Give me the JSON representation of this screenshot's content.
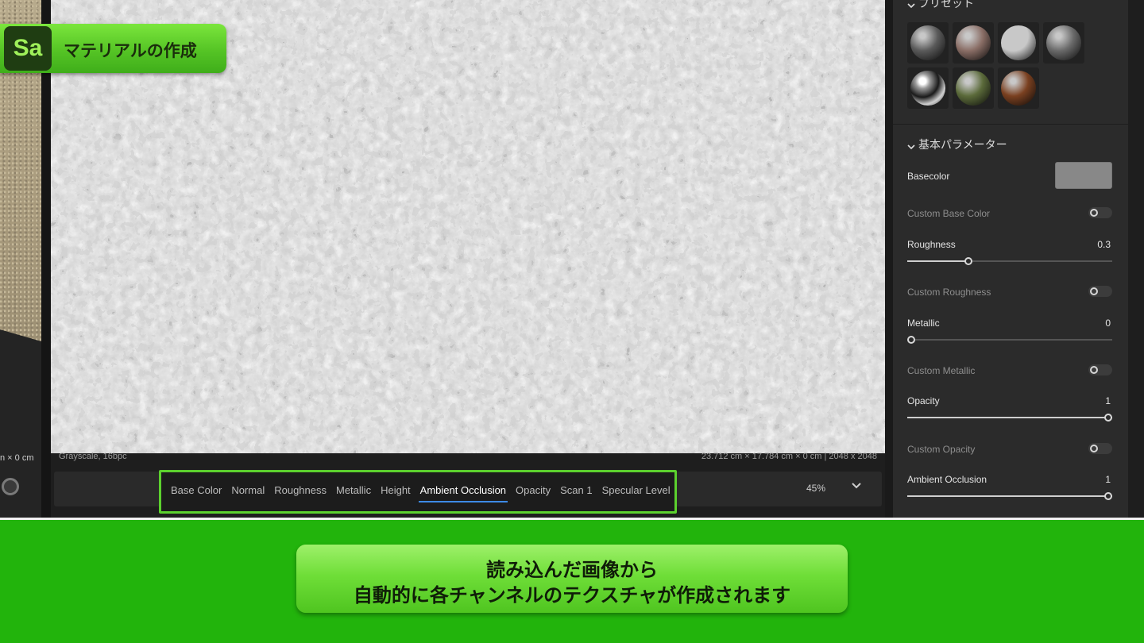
{
  "overlay": {
    "app_logo_text": "Sa",
    "title": "マテリアルの作成",
    "caption_line1": "読み込んだ画像から",
    "caption_line2": "自動的に各チャンネルのテクスチャが作成されます"
  },
  "viewport3d": {
    "dims_text": "n × 0 cm"
  },
  "texture_view": {
    "info_left": "Grayscale, 16bpc",
    "info_right": "23.712 cm × 17.784 cm × 0 cm  |  2048 x 2048"
  },
  "channels": {
    "tabs": [
      "Base Color",
      "Normal",
      "Roughness",
      "Metallic",
      "Height",
      "Ambient Occlusion",
      "Opacity",
      "Scan 1",
      "Specular Level"
    ],
    "active": "Ambient Occlusion"
  },
  "toolbar": {
    "zoom": "45%",
    "zoom_menu_icon": "chevron-down-icon"
  },
  "panel": {
    "presets_title": "プリセット",
    "presets": [
      {
        "name": "preset-dark-gray",
        "color": "#5a5a5a"
      },
      {
        "name": "preset-rosy-brown",
        "color": "#8a6e66"
      },
      {
        "name": "preset-light-gray",
        "color": "#c8c8c8"
      },
      {
        "name": "preset-mid-gray",
        "color": "#6a6a6a"
      },
      {
        "name": "preset-chrome",
        "color": "#2a2a2a"
      },
      {
        "name": "preset-olive",
        "color": "#5b6a3a"
      },
      {
        "name": "preset-copper",
        "color": "#7a4020"
      }
    ],
    "params_title": "基本パラメーター",
    "basecolor_label": "Basecolor",
    "basecolor_value": "#888888",
    "custom_base_color_label": "Custom Base Color",
    "roughness_label": "Roughness",
    "roughness_value": "0.3",
    "custom_roughness_label": "Custom Roughness",
    "metallic_label": "Metallic",
    "metallic_value": "0",
    "custom_metallic_label": "Custom Metallic",
    "opacity_label": "Opacity",
    "opacity_value": "1",
    "custom_opacity_label": "Custom Opacity",
    "ao_label": "Ambient Occlusion",
    "ao_value": "1"
  },
  "colors": {
    "accent_green": "#5cd12e",
    "band_green": "#22b40c",
    "active_tab_underline": "#3d8ae6"
  }
}
